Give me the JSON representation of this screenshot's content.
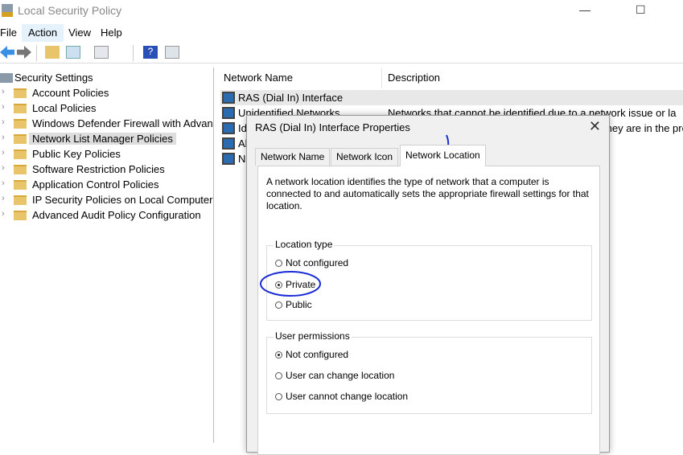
{
  "window": {
    "title": "Local Security Policy",
    "controls": [
      "—",
      "☐"
    ]
  },
  "menu": [
    "File",
    "Action",
    "View",
    "Help"
  ],
  "toolbar": [
    "back-icon",
    "forward-icon",
    "up-folder-icon",
    "show-hide-tree-icon",
    "properties-icon",
    "help-icon",
    "action-pane-icon"
  ],
  "tree": {
    "root": "Security Settings",
    "items": [
      {
        "label": "Account Policies"
      },
      {
        "label": "Local Policies"
      },
      {
        "label": "Windows Defender Firewall with Advanced Security"
      },
      {
        "label": "Network List Manager Policies",
        "selected": true
      },
      {
        "label": "Public Key Policies"
      },
      {
        "label": "Software Restriction Policies"
      },
      {
        "label": "Application Control Policies"
      },
      {
        "label": "IP Security Policies on Local Computer"
      },
      {
        "label": "Advanced Audit Policy Configuration"
      }
    ]
  },
  "list": {
    "columns": [
      "Network Name",
      "Description"
    ],
    "rows": [
      {
        "name": "RAS (Dial In) Interface",
        "desc": ""
      },
      {
        "name": "Unidentified Networks",
        "desc": "Networks that cannot be identified due to a network issue or la"
      },
      {
        "name": "Identifying Networks",
        "desc": "Networks that are in the temporary state while they are in the process of being id"
      },
      {
        "name": "All Networks",
        "desc": ""
      },
      {
        "name": "N",
        "desc": ""
      }
    ]
  },
  "dialog": {
    "title": "RAS (Dial In) Interface Properties",
    "close": "✕",
    "tabs": [
      "Network Name",
      "Network Icon",
      "Network Location"
    ],
    "active_tab": "Network Location",
    "intro": "A network location identifies the type of network that a computer is connected to and automatically sets the appropriate firewall settings for that location.",
    "location_type": {
      "label": "Location type",
      "options": [
        "Not configured",
        "Private",
        "Public"
      ],
      "selected": "Private"
    },
    "user_permissions": {
      "label": "User permissions",
      "options": [
        "Not configured",
        "User can change location",
        "User cannot change location"
      ],
      "selected": "Not configured"
    }
  },
  "annotation_color": "#1a2bd6"
}
